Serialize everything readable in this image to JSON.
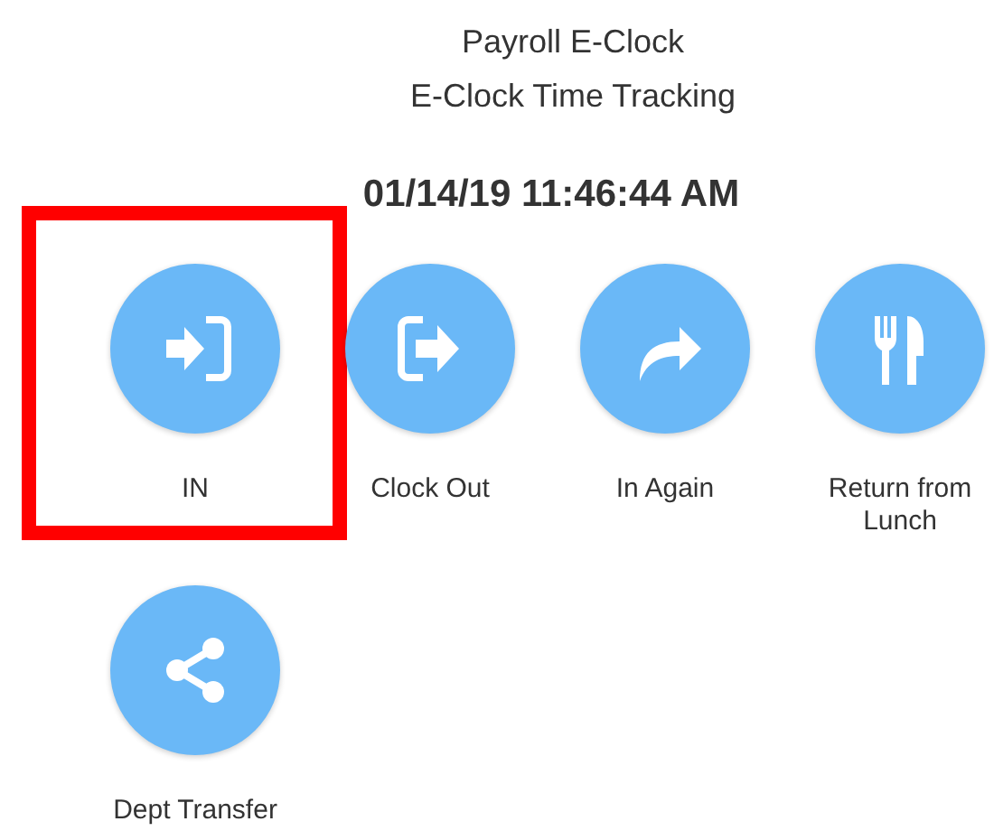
{
  "header": {
    "title": "Payroll E-Clock",
    "subtitle": "E-Clock Time Tracking"
  },
  "datetime": "01/14/19 11:46:44 AM",
  "actions": [
    {
      "label": "IN",
      "kind": "enter",
      "selected": true
    },
    {
      "label": "Clock Out",
      "kind": "exit",
      "selected": false
    },
    {
      "label": "In Again",
      "kind": "redo",
      "selected": false
    },
    {
      "label": "Return from Lunch",
      "kind": "utensils",
      "selected": false
    },
    {
      "label": "Dept Transfer",
      "kind": "share",
      "selected": false
    }
  ]
}
